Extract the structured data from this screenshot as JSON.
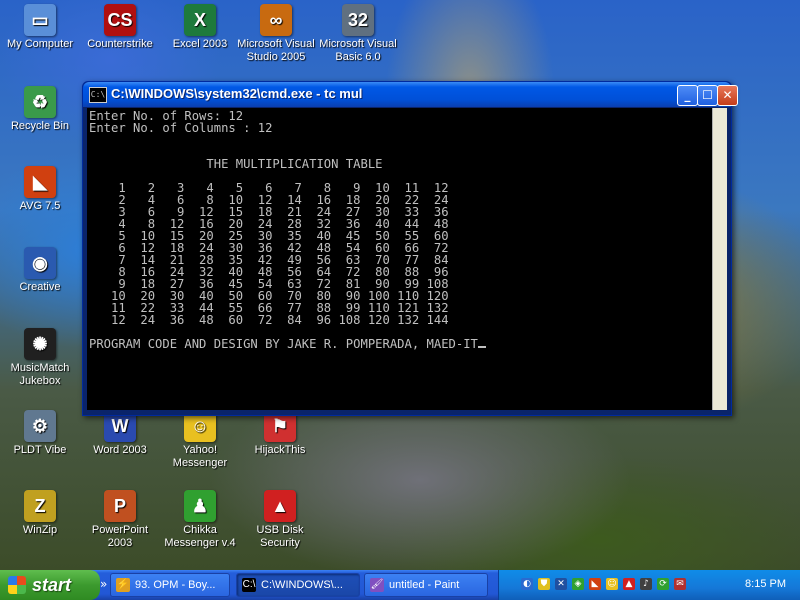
{
  "desktop": {
    "icons": [
      {
        "label": "My Computer",
        "icon": "my-computer-icon",
        "color": "#5a8fd8",
        "glyph": "▭"
      },
      {
        "label": "Counterstrike",
        "icon": "counterstrike-icon",
        "color": "#b01010",
        "glyph": "CS"
      },
      {
        "label": "Excel 2003",
        "icon": "excel-icon",
        "color": "#1e7a3c",
        "glyph": "X"
      },
      {
        "label": "Microsoft Visual Studio 2005",
        "icon": "visual-studio-icon",
        "color": "#c86a10",
        "glyph": "∞"
      },
      {
        "label": "Microsoft Visual Basic 6.0",
        "icon": "visual-basic-icon",
        "color": "#607080",
        "glyph": "32"
      },
      {
        "label": "Recycle Bin",
        "icon": "recycle-bin-icon",
        "color": "#3a9a4a",
        "glyph": "♻"
      },
      {
        "label": "AVG 7.5",
        "icon": "avg-icon",
        "color": "#d04010",
        "glyph": "◣"
      },
      {
        "label": "Creative",
        "icon": "creative-icon",
        "color": "#2a5ab0",
        "glyph": "◉"
      },
      {
        "label": "MusicMatch Jukebox",
        "icon": "musicmatch-icon",
        "color": "#202020",
        "glyph": "✺"
      },
      {
        "label": "PLDT Vibe",
        "icon": "pldt-vibe-icon",
        "color": "#607890",
        "glyph": "⚙"
      },
      {
        "label": "Word 2003",
        "icon": "word-icon",
        "color": "#2a4ab0",
        "glyph": "W"
      },
      {
        "label": "Yahoo! Messenger",
        "icon": "yahoo-messenger-icon",
        "color": "#e8c020",
        "glyph": "☺"
      },
      {
        "label": "HijackThis",
        "icon": "hijackthis-icon",
        "color": "#d03030",
        "glyph": "⚑"
      },
      {
        "label": "WinZip",
        "icon": "winzip-icon",
        "color": "#c0a020",
        "glyph": "Z"
      },
      {
        "label": "PowerPoint 2003",
        "icon": "powerpoint-icon",
        "color": "#c05020",
        "glyph": "P"
      },
      {
        "label": "Chikka Messenger v.4",
        "icon": "chikka-messenger-icon",
        "color": "#30a030",
        "glyph": "♟"
      },
      {
        "label": "USB Disk Security",
        "icon": "usb-disk-security-icon",
        "color": "#d02020",
        "glyph": "▲"
      }
    ]
  },
  "cmd": {
    "title": "C:\\WINDOWS\\system32\\cmd.exe - tc mul",
    "icon_text": "C:\\",
    "minimize": "_",
    "maximize": "☐",
    "close": "✕",
    "lines": [
      "Enter No. of Rows: 12",
      "Enter No. of Columns : 12",
      "",
      "",
      "                THE MULTIPLICATION TABLE",
      "",
      "    1   2   3   4   5   6   7   8   9  10  11  12",
      "    2   4   6   8  10  12  14  16  18  20  22  24",
      "    3   6   9  12  15  18  21  24  27  30  33  36",
      "    4   8  12  16  20  24  28  32  36  40  44  48",
      "    5  10  15  20  25  30  35  40  45  50  55  60",
      "    6  12  18  24  30  36  42  48  54  60  66  72",
      "    7  14  21  28  35  42  49  56  63  70  77  84",
      "    8  16  24  32  40  48  56  64  72  80  88  96",
      "    9  18  27  36  45  54  63  72  81  90  99 108",
      "   10  20  30  40  50  60  70  80  90 100 110 120",
      "   11  22  33  44  55  66  77  88  99 110 121 132",
      "   12  24  36  48  60  72  84  96 108 120 132 144",
      "",
      "PROGRAM CODE AND DESIGN BY JAKE R. POMPERADA, MAED-IT"
    ]
  },
  "taskbar": {
    "start_label": "start",
    "tasks": [
      {
        "label": "93. OPM - Boy...",
        "icon": "winamp-icon",
        "glyph": "⚡",
        "color": "#e0a020"
      },
      {
        "label": "C:\\WINDOWS\\...",
        "icon": "cmd-icon",
        "glyph": "C:\\",
        "color": "#000000"
      },
      {
        "label": "untitled - Paint",
        "icon": "paint-icon",
        "glyph": "🖌",
        "color": "#8050c0"
      }
    ],
    "tray_icons": [
      {
        "icon": "volume-icon",
        "glyph": "◐",
        "color": "#2a6ad0"
      },
      {
        "icon": "antivirus-shield-icon",
        "glyph": "⛊",
        "color": "#e0c020"
      },
      {
        "icon": "security-icon",
        "glyph": "✕",
        "color": "#2050a0"
      },
      {
        "icon": "network-icon",
        "glyph": "◈",
        "color": "#30a030"
      },
      {
        "icon": "avg-tray-icon",
        "glyph": "◣",
        "color": "#d04010"
      },
      {
        "icon": "messenger-tray-icon",
        "glyph": "☺",
        "color": "#e8c020"
      },
      {
        "icon": "usb-tray-icon",
        "glyph": "▲",
        "color": "#d02020"
      },
      {
        "icon": "speaker-icon",
        "glyph": "♪",
        "color": "#404040"
      },
      {
        "icon": "update-icon",
        "glyph": "⟳",
        "color": "#30a030"
      },
      {
        "icon": "chat-icon",
        "glyph": "✉",
        "color": "#b03030"
      }
    ],
    "clock": "8:15 PM"
  }
}
